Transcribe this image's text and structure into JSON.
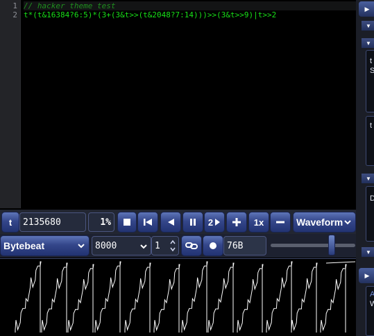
{
  "editor": {
    "lines": [
      {
        "num": "1",
        "text": "// hacker theme test",
        "kind": "comment"
      },
      {
        "num": "2",
        "text": "t*(t&16384?6:5)*(3+(3&t>>(t&2048?7:14)))>>(3&t>>9)|t>>2",
        "kind": "code"
      }
    ]
  },
  "controls": {
    "time_label": "t",
    "time_value": "2135680",
    "speed_percent": "1%",
    "step_value": "2",
    "playback_rate": "1x",
    "view_mode": "Waveform",
    "mode": "Bytebeat",
    "sample_rate": "8000",
    "divisor": "1",
    "size": "76B"
  },
  "scale_level": 0.72,
  "colors": {
    "comment": "#1f8f1f",
    "code": "#18e018",
    "accent": "#34468a",
    "waveform": "#ffffff"
  },
  "side": {
    "letters": [
      "t",
      "S",
      "t",
      "D",
      "A",
      "W"
    ]
  }
}
